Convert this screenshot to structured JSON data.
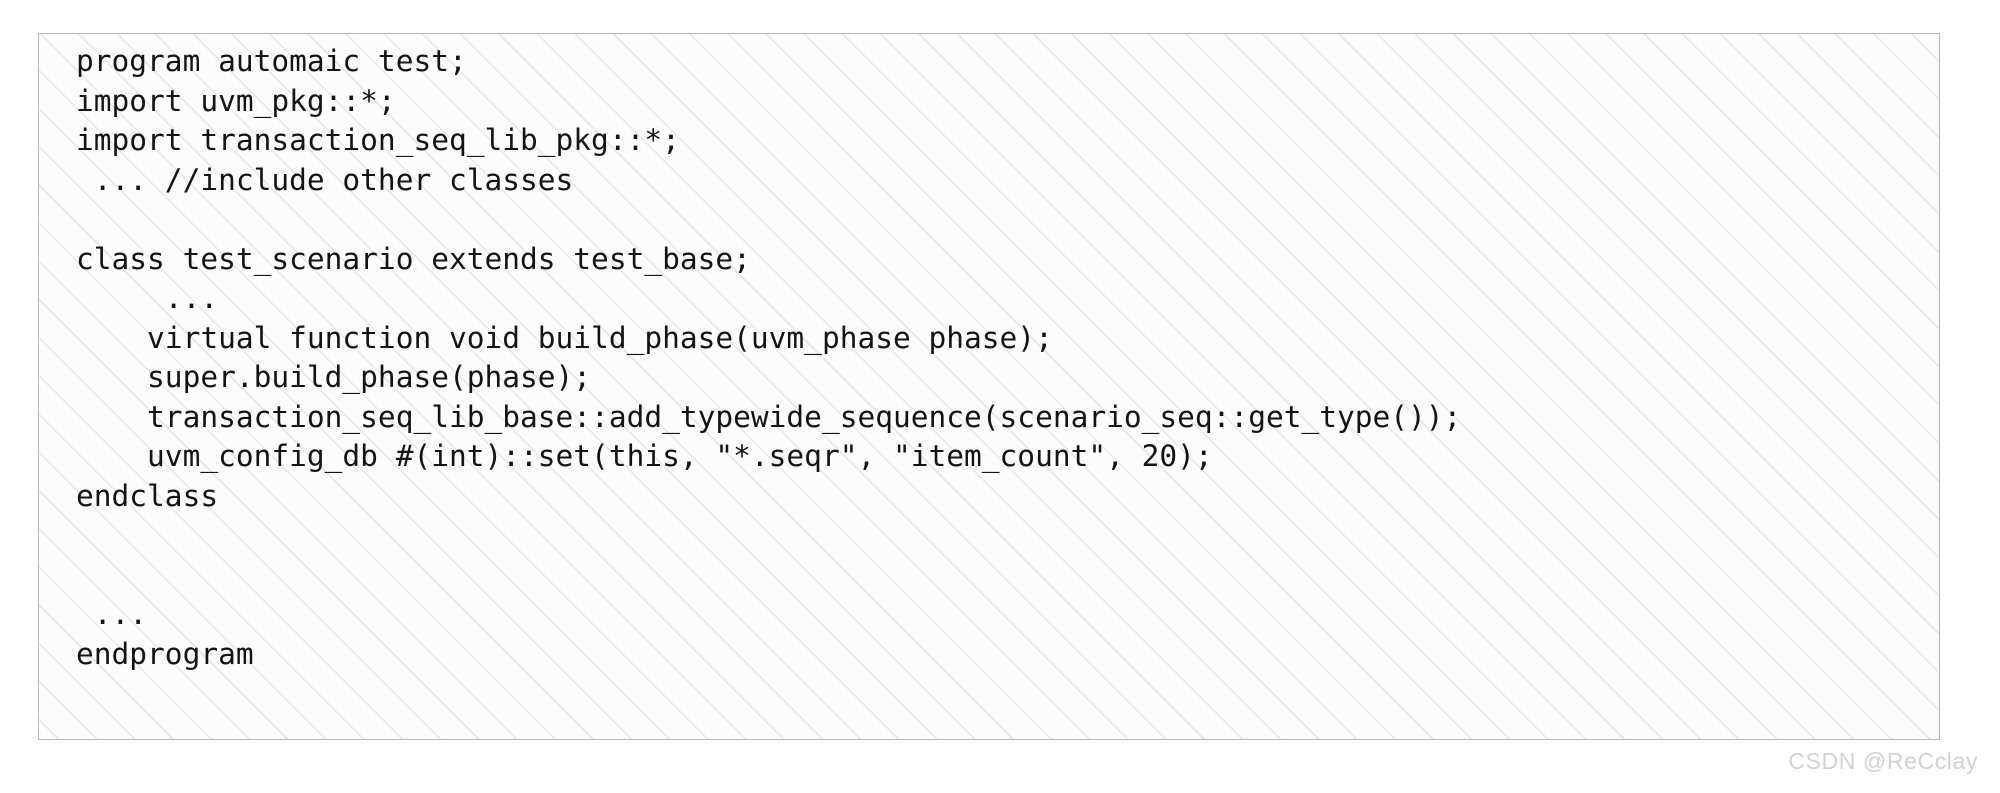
{
  "code_panel": {
    "language": "systemverilog",
    "border_color": "#b9b9b9",
    "background_color": "#fcfcfc",
    "hatch_color": "#787878",
    "text_color": "#141414",
    "lines": [
      "program automaic test;",
      "import uvm_pkg::*;",
      "import transaction_seq_lib_pkg::*;",
      " ... //include other classes",
      "",
      "class test_scenario extends test_base;",
      "     ...",
      "    virtual function void build_phase(uvm_phase phase);",
      "    super.build_phase(phase);",
      "    transaction_seq_lib_base::add_typewide_sequence(scenario_seq::get_type());",
      "    uvm_config_db #(int)::set(this, \"*.seqr\", \"item_count\", 20);",
      "endclass",
      "",
      "",
      " ...",
      "endprogram"
    ]
  },
  "watermark": {
    "text": "CSDN @ReCclay",
    "color": "#d2d2d2"
  }
}
